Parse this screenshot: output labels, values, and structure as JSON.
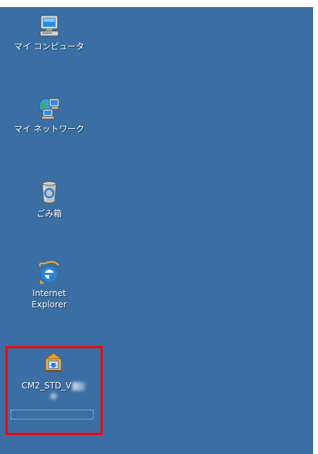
{
  "desktop": {
    "background_color": "#3a6ea5",
    "highlight_color": "#ff0000",
    "icons": [
      {
        "label": "マイ コンピュータ",
        "icon": "computer-icon"
      },
      {
        "label": "マイ ネットワーク",
        "icon": "network-icon"
      },
      {
        "label": "ごみ箱",
        "icon": "recycle-bin-icon"
      },
      {
        "label_line1": "Internet",
        "label_line2": "Explorer",
        "icon": "internet-explorer-icon"
      },
      {
        "label": "CM2_STD_V",
        "icon": "installer-package-icon",
        "selected": true
      }
    ]
  }
}
